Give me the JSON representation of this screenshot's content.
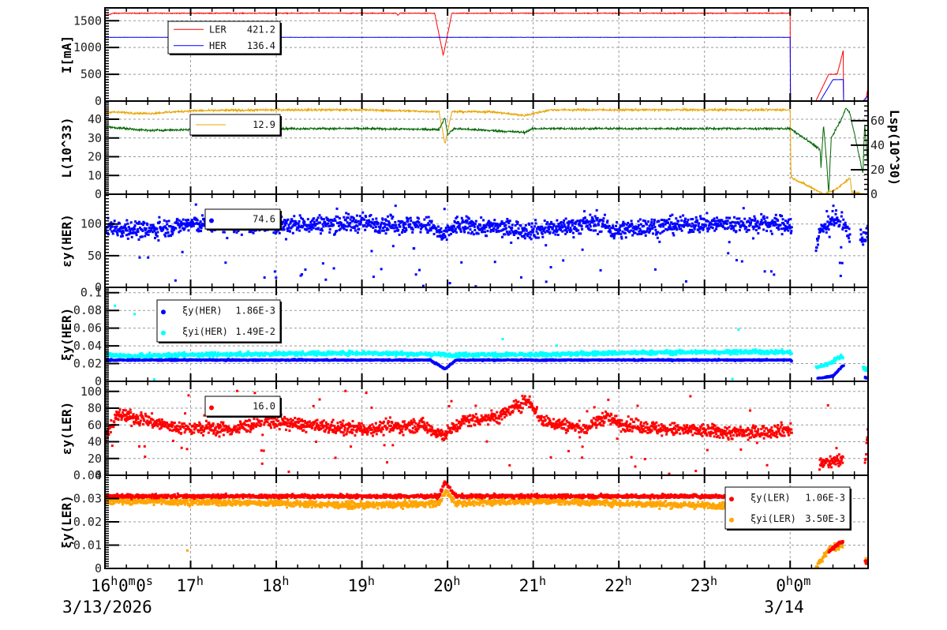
{
  "chart_data": {
    "type": "line",
    "x_unit": "hour",
    "xlim": [
      16,
      24.91
    ],
    "x_ticks": [
      {
        "t": 16,
        "label": "16h0m0s"
      },
      {
        "t": 17,
        "label": "17h"
      },
      {
        "t": 18,
        "label": "18h"
      },
      {
        "t": 19,
        "label": "19h"
      },
      {
        "t": 20,
        "label": "20h"
      },
      {
        "t": 21,
        "label": "21h"
      },
      {
        "t": 22,
        "label": "22h"
      },
      {
        "t": 23,
        "label": "23h"
      },
      {
        "t": 24,
        "label": "0h0m"
      }
    ],
    "date_labels": [
      {
        "t": 16,
        "label": "3/13/2026"
      },
      {
        "t": 24,
        "label": "3/14"
      }
    ],
    "panels": [
      {
        "ylabel": "I[mA]",
        "ylim": [
          0,
          1740
        ],
        "yticks": [
          0,
          500,
          1000,
          1500
        ],
        "legend": {
          "entries": [
            {
              "label": "LER",
              "value": "421.2",
              "color": "#ff0000",
              "kind": "line"
            },
            {
              "label": "HER",
              "value": "136.4",
              "color": "#0000ff",
              "kind": "line"
            }
          ]
        },
        "series": [
          {
            "name": "LER",
            "color": "#ff0000",
            "kind": "line",
            "noise": 8,
            "points": [
              [
                16,
                1600
              ],
              [
                16.1,
                1640
              ],
              [
                19.4,
                1640
              ],
              [
                19.42,
                1600
              ],
              [
                19.44,
                1640
              ],
              [
                19.85,
                1640
              ],
              [
                19.95,
                850
              ],
              [
                20.05,
                1640
              ],
              [
                24.0,
                1640
              ],
              [
                24.001,
                0
              ],
              [
                24.3,
                0
              ],
              [
                24.45,
                500
              ],
              [
                24.55,
                500
              ],
              [
                24.62,
                950
              ],
              [
                24.621,
                0
              ],
              [
                24.88,
                0
              ],
              [
                24.91,
                250
              ]
            ]
          },
          {
            "name": "HER",
            "color": "#0000ff",
            "kind": "line",
            "noise": 3,
            "points": [
              [
                16,
                1190
              ],
              [
                24.0,
                1190
              ],
              [
                24.001,
                0
              ],
              [
                24.35,
                0
              ],
              [
                24.5,
                400
              ],
              [
                24.62,
                400
              ],
              [
                24.621,
                0
              ],
              [
                24.85,
                0
              ],
              [
                24.91,
                100
              ]
            ]
          }
        ]
      },
      {
        "ylabel": "L(10^33)",
        "ylim": [
          0,
          49.7
        ],
        "yticks": [
          0,
          10,
          20,
          30,
          40
        ],
        "y2label": "Lsp(10^30)",
        "y2lim": [
          0,
          76
        ],
        "y2ticks": [
          0,
          20,
          40,
          60
        ],
        "legend": {
          "entries": [
            {
              "label": "",
              "value": "12.9",
              "color": "#e8a400",
              "kind": "line"
            }
          ]
        },
        "series": [
          {
            "name": "L",
            "color": "#e8a400",
            "kind": "line",
            "noise": 0.6,
            "points": [
              [
                16,
                44
              ],
              [
                16.5,
                43
              ],
              [
                17,
                44.5
              ],
              [
                18,
                45
              ],
              [
                19,
                45
              ],
              [
                19.9,
                44
              ],
              [
                19.97,
                27
              ],
              [
                20.05,
                44
              ],
              [
                20.5,
                44
              ],
              [
                20.9,
                42
              ],
              [
                21.2,
                45
              ],
              [
                22,
                45
              ],
              [
                23,
                45
              ],
              [
                24.0,
                45
              ],
              [
                24.01,
                9
              ],
              [
                24.4,
                0
              ],
              [
                24.45,
                1
              ],
              [
                24.55,
                3
              ],
              [
                24.63,
                6
              ],
              [
                24.7,
                9
              ],
              [
                24.72,
                1
              ],
              [
                24.91,
                0
              ]
            ]
          },
          {
            "name": "Lsp",
            "color": "#006400",
            "kind": "line",
            "noise": 0.6,
            "points": [
              [
                16,
                36
              ],
              [
                16.5,
                34
              ],
              [
                17,
                34.5
              ],
              [
                18,
                35
              ],
              [
                19,
                35
              ],
              [
                19.9,
                34.5
              ],
              [
                19.97,
                41
              ],
              [
                20.0,
                32
              ],
              [
                20.08,
                35
              ],
              [
                20.9,
                33
              ],
              [
                21.0,
                35
              ],
              [
                24.0,
                35
              ],
              [
                24.35,
                24
              ],
              [
                24.36,
                14
              ],
              [
                24.39,
                37
              ],
              [
                24.43,
                15
              ],
              [
                24.45,
                0
              ],
              [
                24.48,
                30
              ],
              [
                24.55,
                36
              ],
              [
                24.6,
                40
              ],
              [
                24.65,
                46
              ],
              [
                24.7,
                43
              ],
              [
                24.85,
                11
              ],
              [
                24.87,
                38
              ],
              [
                24.91,
                13
              ]
            ]
          }
        ]
      },
      {
        "ylabel": "εy(HER)",
        "ylim": [
          0,
          147
        ],
        "yticks": [
          0,
          50,
          100
        ],
        "legend": {
          "entries": [
            {
              "label": "",
              "value": "74.6",
              "color": "#0000ff",
              "kind": "dot"
            }
          ]
        },
        "series": [
          {
            "name": "εy(HER)",
            "color": "#0000ff",
            "kind": "scatter",
            "spread": 7,
            "outlier": 0.04,
            "points": [
              [
                16,
                95
              ],
              [
                16.5,
                90
              ],
              [
                17,
                100
              ],
              [
                18,
                98
              ],
              [
                19,
                102
              ],
              [
                19.8,
                97
              ],
              [
                19.95,
                80
              ],
              [
                20.1,
                98
              ],
              [
                21,
                90
              ],
              [
                21.8,
                102
              ],
              [
                21.95,
                88
              ],
              [
                22.2,
                95
              ],
              [
                23,
                100
              ],
              [
                24.0,
                100
              ],
              [
                24.3,
                55
              ],
              [
                24.35,
                90
              ],
              [
                24.5,
                110
              ],
              [
                24.6,
                100
              ],
              [
                24.7,
                85
              ],
              [
                24.8,
                75
              ],
              [
                24.91,
                85
              ]
            ],
            "gaps": [
              [
                24.02,
                24.3
              ],
              [
                24.7,
                24.82
              ]
            ]
          }
        ]
      },
      {
        "ylabel": "ξy(HER)",
        "ylim": [
          0,
          0.106
        ],
        "yticks": [
          0,
          0.02,
          0.04,
          0.06,
          0.08,
          0.1
        ],
        "legend": {
          "entries": [
            {
              "label": "ξy(HER)",
              "value": "1.86E-3",
              "color": "#0000ff",
              "kind": "dot"
            },
            {
              "label": "ξyi(HER)",
              "value": "1.49E-2",
              "color": "#00ffff",
              "kind": "dot"
            }
          ]
        },
        "series": [
          {
            "name": "ξyi(HER)",
            "color": "#00ffff",
            "kind": "scatter",
            "spread": 0.0012,
            "outlier": 0.008,
            "points": [
              [
                16,
                0.03
              ],
              [
                16.3,
                0.028
              ],
              [
                17,
                0.03
              ],
              [
                18,
                0.031
              ],
              [
                19,
                0.032
              ],
              [
                20,
                0.03
              ],
              [
                21,
                0.03
              ],
              [
                22,
                0.032
              ],
              [
                23,
                0.033
              ],
              [
                24.0,
                0.033
              ],
              [
                24.3,
                0.015
              ],
              [
                24.45,
                0.02
              ],
              [
                24.6,
                0.028
              ],
              [
                24.91,
                0.012
              ]
            ],
            "gaps": [
              [
                24.02,
                24.3
              ],
              [
                24.62,
                24.85
              ]
            ]
          },
          {
            "name": "ξy(HER)",
            "color": "#0000ff",
            "kind": "scatter",
            "spread": 0.0004,
            "outlier": 0,
            "points": [
              [
                16,
                0.024
              ],
              [
                19.8,
                0.024
              ],
              [
                19.97,
                0.014
              ],
              [
                20.1,
                0.024
              ],
              [
                24.0,
                0.024
              ],
              [
                24.3,
                0.003
              ],
              [
                24.5,
                0.006
              ],
              [
                24.62,
                0.018
              ],
              [
                24.91,
                0.003
              ]
            ],
            "gaps": [
              [
                24.02,
                24.32
              ],
              [
                24.63,
                24.87
              ]
            ]
          }
        ]
      },
      {
        "ylabel": "εy(LER)",
        "ylim": [
          0,
          112
        ],
        "yticks": [
          0,
          20,
          40,
          60,
          80,
          100
        ],
        "legend": {
          "entries": [
            {
              "label": "",
              "value": "16.0",
              "color": "#ff0000",
              "kind": "dot"
            }
          ]
        },
        "series": [
          {
            "name": "εy(LER)",
            "color": "#ff0000",
            "kind": "scatter",
            "spread": 4,
            "outlier": 0.03,
            "points": [
              [
                16,
                45
              ],
              [
                16.15,
                72
              ],
              [
                16.4,
                68
              ],
              [
                16.8,
                57
              ],
              [
                17.5,
                55
              ],
              [
                17.9,
                65
              ],
              [
                18.5,
                58
              ],
              [
                19,
                55
              ],
              [
                19.7,
                60
              ],
              [
                19.95,
                48
              ],
              [
                20.2,
                65
              ],
              [
                20.6,
                70
              ],
              [
                20.95,
                90
              ],
              [
                21.1,
                65
              ],
              [
                21.6,
                55
              ],
              [
                21.85,
                70
              ],
              [
                22,
                62
              ],
              [
                22.5,
                55
              ],
              [
                23,
                53
              ],
              [
                23.5,
                50
              ],
              [
                24.0,
                55
              ],
              [
                24.35,
                14
              ],
              [
                24.6,
                18
              ],
              [
                24.88,
                20
              ],
              [
                24.91,
                55
              ]
            ],
            "gaps": [
              [
                24.02,
                24.34
              ],
              [
                24.62,
                24.87
              ]
            ]
          }
        ]
      },
      {
        "ylabel": "ξy(LER)",
        "ylim": [
          0,
          0.04
        ],
        "yticks": [
          0,
          0.01,
          0.02,
          0.03,
          0.04
        ],
        "legend": {
          "entries": [
            {
              "label": "ξy(LER)",
              "value": "1.06E-3",
              "color": "#ff0000",
              "kind": "dot"
            },
            {
              "label": "ξyi(LER)",
              "value": "3.50E-3",
              "color": "#ffa500",
              "kind": "dot"
            }
          ]
        },
        "series": [
          {
            "name": "ξyi(LER)",
            "color": "#ffa500",
            "kind": "scatter",
            "spread": 0.0007,
            "outlier": 0.003,
            "points": [
              [
                16,
                0.029
              ],
              [
                18,
                0.028
              ],
              [
                19,
                0.027
              ],
              [
                19.9,
                0.028
              ],
              [
                19.98,
                0.033
              ],
              [
                20.1,
                0.028
              ],
              [
                21,
                0.029
              ],
              [
                22,
                0.028
              ],
              [
                23,
                0.027
              ],
              [
                24.0,
                0.028
              ],
              [
                24.3,
                0.0
              ],
              [
                24.45,
                0.008
              ],
              [
                24.6,
                0.01
              ],
              [
                24.91,
                0.003
              ]
            ],
            "gaps": [
              [
                24.02,
                24.3
              ],
              [
                24.62,
                24.87
              ]
            ]
          },
          {
            "name": "ξy(LER)",
            "color": "#ff0000",
            "kind": "scatter",
            "spread": 0.0004,
            "outlier": 0,
            "points": [
              [
                16,
                0.031
              ],
              [
                19.9,
                0.031
              ],
              [
                19.97,
                0.037
              ],
              [
                20.1,
                0.031
              ],
              [
                24.0,
                0.031
              ],
              [
                24.45,
                0.007
              ],
              [
                24.6,
                0.012
              ],
              [
                24.91,
                0.002
              ]
            ],
            "gaps": [
              [
                24.02,
                24.45
              ],
              [
                24.62,
                24.87
              ]
            ]
          }
        ]
      }
    ]
  }
}
